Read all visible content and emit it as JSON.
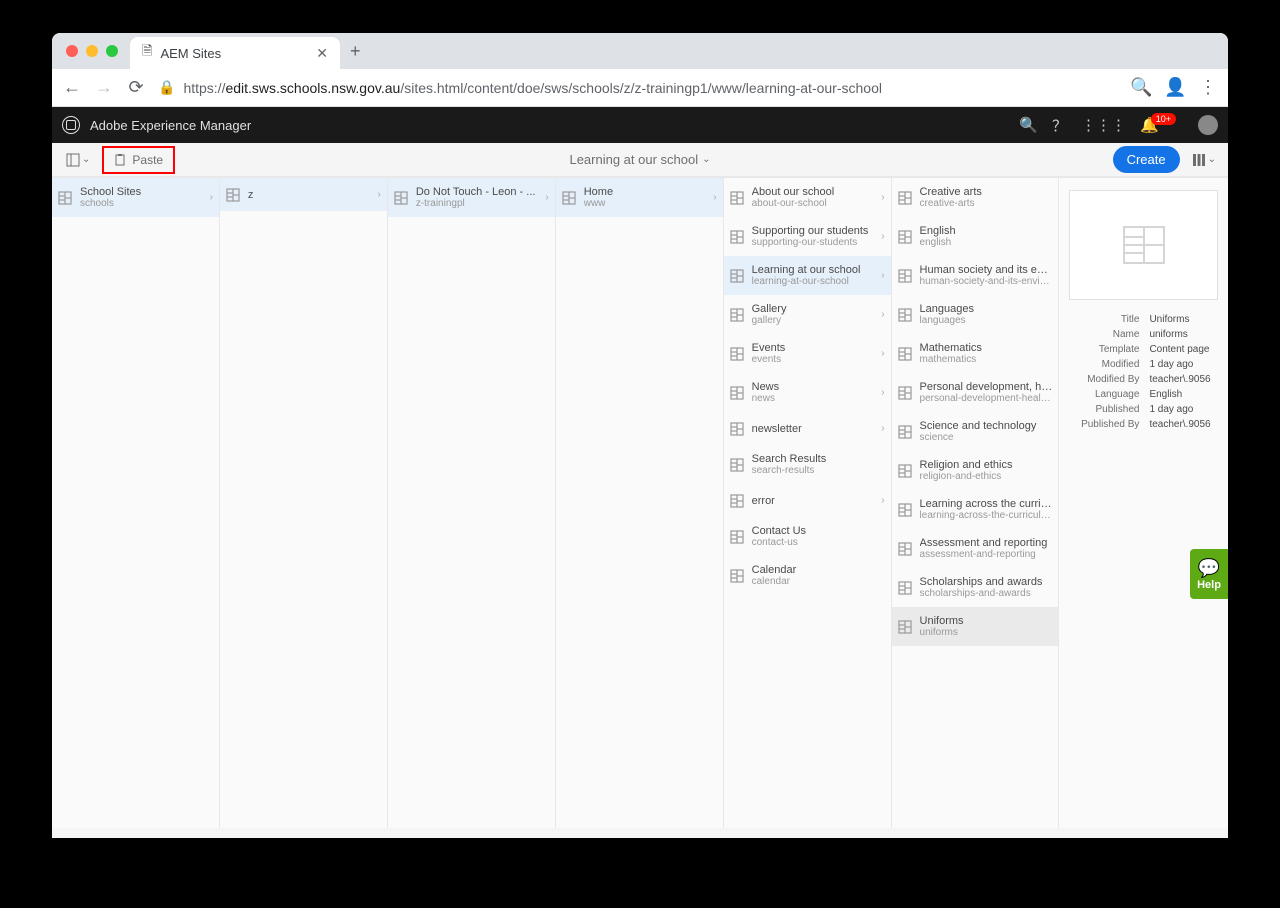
{
  "browser": {
    "tab_title": "AEM Sites",
    "url_prefix": "https://",
    "url_host": "edit.sws.schools.nsw.gov.au",
    "url_path": "/sites.html/content/doe/sws/schools/z/z-trainingp1/www/learning-at-our-school"
  },
  "aem_header": {
    "title": "Adobe Experience Manager",
    "notif_count": "10+"
  },
  "toolbar": {
    "paste_label": "Paste",
    "breadcrumb": "Learning at our school",
    "create_label": "Create"
  },
  "cols": [
    {
      "items": [
        {
          "title": "School Sites",
          "sub": "schools",
          "sel": true,
          "chev": true
        }
      ]
    },
    {
      "items": [
        {
          "title": "z",
          "sub": "",
          "sel": true,
          "chev": true
        }
      ]
    },
    {
      "items": [
        {
          "title": "Do Not Touch - Leon - ...",
          "sub": "z-trainingpl",
          "sel": true,
          "chev": true
        }
      ]
    },
    {
      "items": [
        {
          "title": "Home",
          "sub": "www",
          "sel": true,
          "chev": true
        }
      ]
    },
    {
      "items": [
        {
          "title": "About our school",
          "sub": "about-our-school",
          "chev": true
        },
        {
          "title": "Supporting our students",
          "sub": "supporting-our-students",
          "chev": true
        },
        {
          "title": "Learning at our school",
          "sub": "learning-at-our-school",
          "sel": true,
          "chev": true
        },
        {
          "title": "Gallery",
          "sub": "gallery",
          "chev": true
        },
        {
          "title": "Events",
          "sub": "events",
          "chev": true
        },
        {
          "title": "News",
          "sub": "news",
          "chev": true
        },
        {
          "title": "newsletter",
          "sub": "",
          "chev": true
        },
        {
          "title": "Search Results",
          "sub": "search-results"
        },
        {
          "title": "error",
          "sub": "",
          "chev": true
        },
        {
          "title": "Contact Us",
          "sub": "contact-us"
        },
        {
          "title": "Calendar",
          "sub": "calendar"
        }
      ]
    },
    {
      "items": [
        {
          "title": "Creative arts",
          "sub": "creative-arts"
        },
        {
          "title": "English",
          "sub": "english"
        },
        {
          "title": "Human society and its environ...",
          "sub": "human-society-and-its-enviro..."
        },
        {
          "title": "Languages",
          "sub": "languages"
        },
        {
          "title": "Mathematics",
          "sub": "mathematics"
        },
        {
          "title": "Personal development, health ...",
          "sub": "personal-development-health..."
        },
        {
          "title": "Science and technology",
          "sub": "science"
        },
        {
          "title": "Religion and ethics",
          "sub": "religion-and-ethics"
        },
        {
          "title": "Learning across the curriculum",
          "sub": "learning-across-the-curriculum"
        },
        {
          "title": "Assessment and reporting",
          "sub": "assessment-and-reporting"
        },
        {
          "title": "Scholarships and awards",
          "sub": "scholarships-and-awards"
        },
        {
          "title": "Uniforms",
          "sub": "uniforms",
          "hl": true
        }
      ]
    }
  ],
  "detail": {
    "meta": [
      {
        "k": "Title",
        "v": "Uniforms"
      },
      {
        "k": "Name",
        "v": "uniforms"
      },
      {
        "k": "Template",
        "v": "Content page"
      },
      {
        "k": "Modified",
        "v": "1 day ago"
      },
      {
        "k": "Modified By",
        "v": "teacher\\.9056"
      },
      {
        "k": "Language",
        "v": "English"
      },
      {
        "k": "Published",
        "v": "1 day ago"
      },
      {
        "k": "Published By",
        "v": "teacher\\.9056"
      }
    ]
  },
  "help_label": "Help"
}
